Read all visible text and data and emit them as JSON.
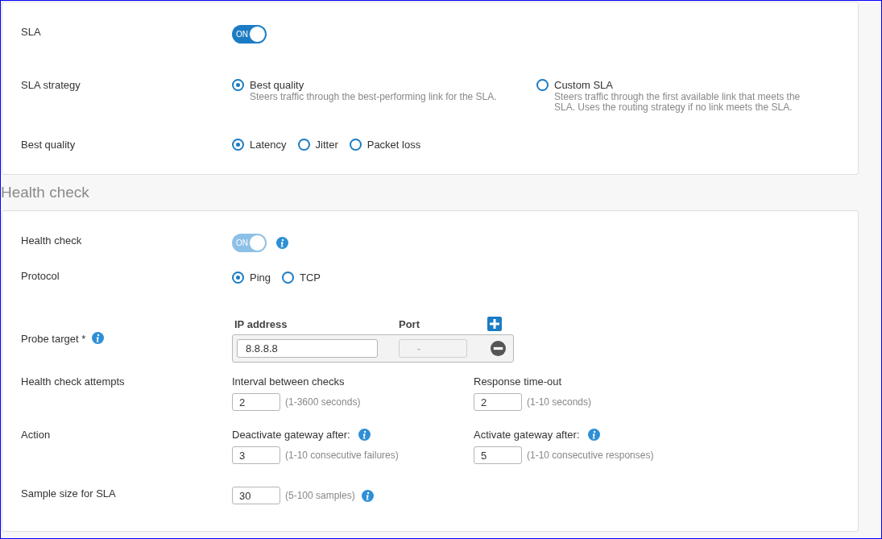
{
  "sla_card": {
    "sla": {
      "label": "SLA",
      "toggle": {
        "text": "ON",
        "on": true,
        "disabled": false
      }
    },
    "strategy": {
      "label": "SLA strategy",
      "options": [
        {
          "label": "Best quality",
          "description": "Steers traffic through the best-performing link for the SLA.",
          "selected": true
        },
        {
          "label": "Custom SLA",
          "description": "Steers traffic through the first available link that meets the SLA. Uses the routing strategy if no link meets the SLA.",
          "selected": false
        }
      ]
    },
    "best_quality": {
      "label": "Best quality",
      "options": [
        {
          "label": "Latency",
          "selected": true
        },
        {
          "label": "Jitter",
          "selected": false
        },
        {
          "label": "Packet loss",
          "selected": false
        }
      ]
    }
  },
  "health_heading": "Health check",
  "health_card": {
    "health_check": {
      "label": "Health check",
      "info": true,
      "toggle": {
        "text": "ON",
        "on": true,
        "disabled": true
      }
    },
    "protocol": {
      "label": "Protocol",
      "options": [
        {
          "label": "Ping",
          "selected": true
        },
        {
          "label": "TCP",
          "selected": false
        }
      ]
    },
    "probe_target": {
      "label": "Probe target *",
      "info": true,
      "columns": [
        "IP address",
        "Port"
      ],
      "rows": [
        {
          "ip": "8.8.8.8",
          "port": "-"
        }
      ]
    },
    "attempts": {
      "label": "Health check attempts",
      "fields": [
        {
          "label": "Interval between checks",
          "value": "2",
          "hint": "(1-3600 seconds)"
        },
        {
          "label": "Response time-out",
          "value": "2",
          "hint": "(1-10 seconds)"
        }
      ]
    },
    "action": {
      "label": "Action",
      "fields": [
        {
          "label": "Deactivate gateway after:",
          "value": "3",
          "hint": "(1-10 consecutive failures)",
          "info": true
        },
        {
          "label": "Activate gateway after:",
          "value": "5",
          "hint": "(1-10 consecutive responses)",
          "info": true
        }
      ]
    },
    "sample_size": {
      "label": "Sample size for SLA",
      "value": "30",
      "hint": "(5-100 samples)",
      "info": true
    }
  }
}
